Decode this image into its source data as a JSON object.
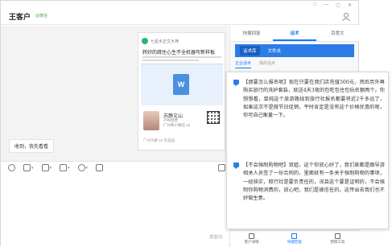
{
  "window": {
    "contact_name": "王客户",
    "contact_tag": "@微信",
    "controls": [
      "□",
      "—",
      "▢",
      "✕"
    ]
  },
  "chat": {
    "card": {
      "source": "七星水正文大神",
      "title": "转好的疏住心生不全机器写新样板",
      "doc_icon": "W",
      "author": "苏静文山",
      "meta1": "产权经营",
      "meta2": "广州和小微信 12",
      "footer": "广州鸿蒙 12 年美国"
    },
    "incoming_message": "收到，我先看看"
  },
  "toolbar": {
    "send_hint": "发送(S)"
  },
  "panel": {
    "tabs": [
      "快捷回复",
      "话术",
      "百度文"
    ],
    "active_tab": 1,
    "pills": [
      "话术库",
      "文件夹"
    ],
    "subtabs": [
      "企业话术",
      "我的话术"
    ],
    "bottom_nav": [
      "客户详情",
      "快捷回复",
      "营销工具"
    ]
  },
  "replies": [
    "【那要怎么报名呢】现在只要在我们店充值500元，然后另外再购买旅行的洗护套装，就送4天3夜的包吃包住包玩名额两个。你想想看，单纯这个旅游路线到旅行社报名都要将近2千多远了，如果这次不是做节日促销，平时肯定是没有这个价格优惠的呢，你可自己衡量一下。",
    "【不会强制购物吧】双姐，这个你放心好了，我们家都是跟导游相关人员签了一份合同的，里面就有一条关于强制购物的事项，一经核实，取行社是要负责任的，况且这个要是证明的，不会强制你购物消费的，放心吧，我们是被信任的。这传出去我们也不好做生意。"
  ]
}
